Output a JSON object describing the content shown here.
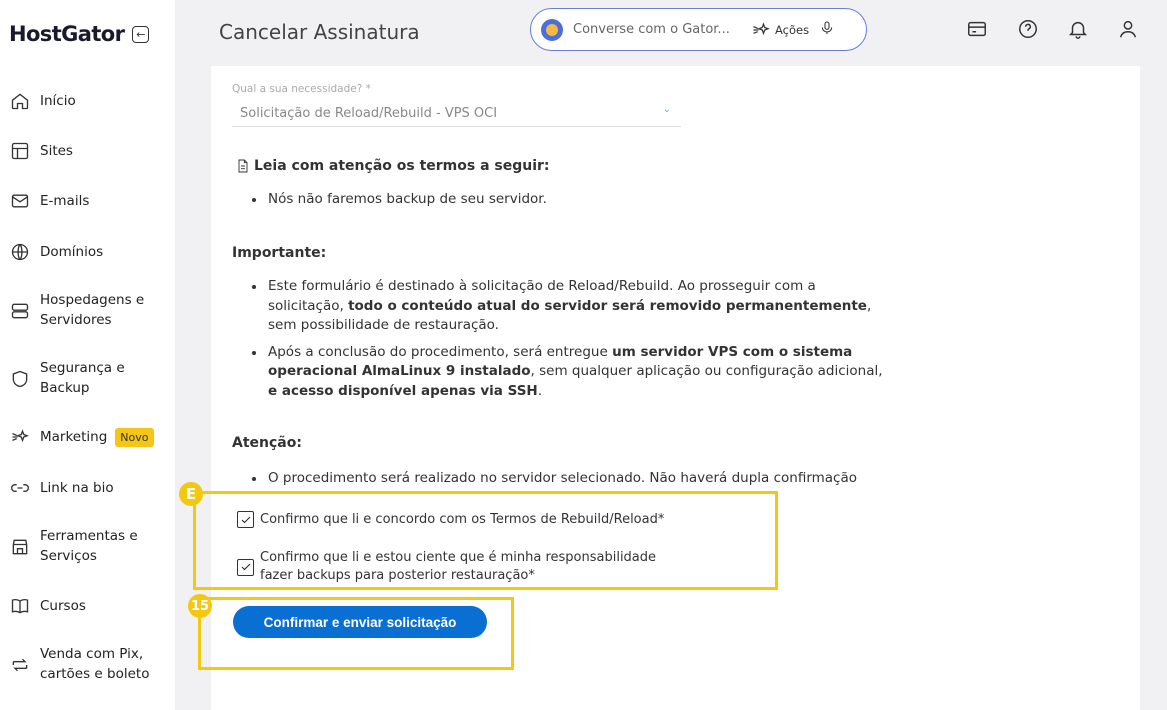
{
  "brand": {
    "logo": "HostGator",
    "collapse_icon": "←"
  },
  "sidebar": {
    "items": [
      {
        "label": "Início",
        "icon": "home-icon"
      },
      {
        "label": "Sites",
        "icon": "layout-icon"
      },
      {
        "label": "E-mails",
        "icon": "mail-icon"
      },
      {
        "label": "Domínios",
        "icon": "globe-icon"
      },
      {
        "label": "Hospedagens e Servidores",
        "icon": "server-icon"
      },
      {
        "label": "Segurança e Backup",
        "icon": "shield-icon"
      },
      {
        "label": "Marketing",
        "icon": "sparkle-icon",
        "badge": "Novo"
      },
      {
        "label": "Link na bio",
        "icon": "link-icon"
      },
      {
        "label": "Ferramentas e Serviços",
        "icon": "store-icon"
      },
      {
        "label": "Cursos",
        "icon": "book-icon"
      },
      {
        "label": "Venda com Pix, cartões e boleto",
        "icon": "exchange-icon"
      }
    ]
  },
  "header": {
    "title": "Cancelar Assinatura",
    "search_placeholder": "Converse com o Gator...",
    "actions_label": "Ações"
  },
  "form": {
    "select_label": "Qual a sua necessidade? *",
    "select_value": "Solicitação de Reload/Rebuild - VPS OCI",
    "terms_heading": "Leia com atenção os termos a seguir:",
    "terms_bullets": [
      "Nós não faremos backup de seu servidor."
    ],
    "important_title": "Importante:",
    "important_bullet_1": {
      "pre": "Este formulário é destinado à solicitação de Reload/Rebuild. Ao prosseguir com a solicitação, ",
      "bold": "todo o conteúdo atual do servidor será removido permanentemente",
      "post": ", sem possibilidade de restauração."
    },
    "important_bullet_2": {
      "pre": "Após a conclusão do procedimento, será entregue ",
      "bold1": "um servidor VPS com o sistema operacional AlmaLinux 9 instalado",
      "mid": ", sem qualquer aplicação ou configuração adicional, ",
      "bold2": "e acesso disponível apenas via SSH",
      "post": "."
    },
    "attention_title": "Atenção:",
    "attention_bullets": [
      "O procedimento será realizado no servidor selecionado. Não haverá dupla confirmação"
    ],
    "checkbox_1": "Confirmo que li e concordo com os Termos de Rebuild/Reload*",
    "checkbox_2": "Confirmo que li e estou ciente que é minha responsabilidade fazer backups para posterior restauração*",
    "submit_label": "Confirmar e enviar solicitação"
  },
  "annotations": {
    "badge_1": "E",
    "badge_2": "15",
    "color": "#f2c811"
  },
  "colors": {
    "primary_button": "#0a6fd3",
    "search_border": "#6a7bdc",
    "badge_new": "#f5c518"
  }
}
